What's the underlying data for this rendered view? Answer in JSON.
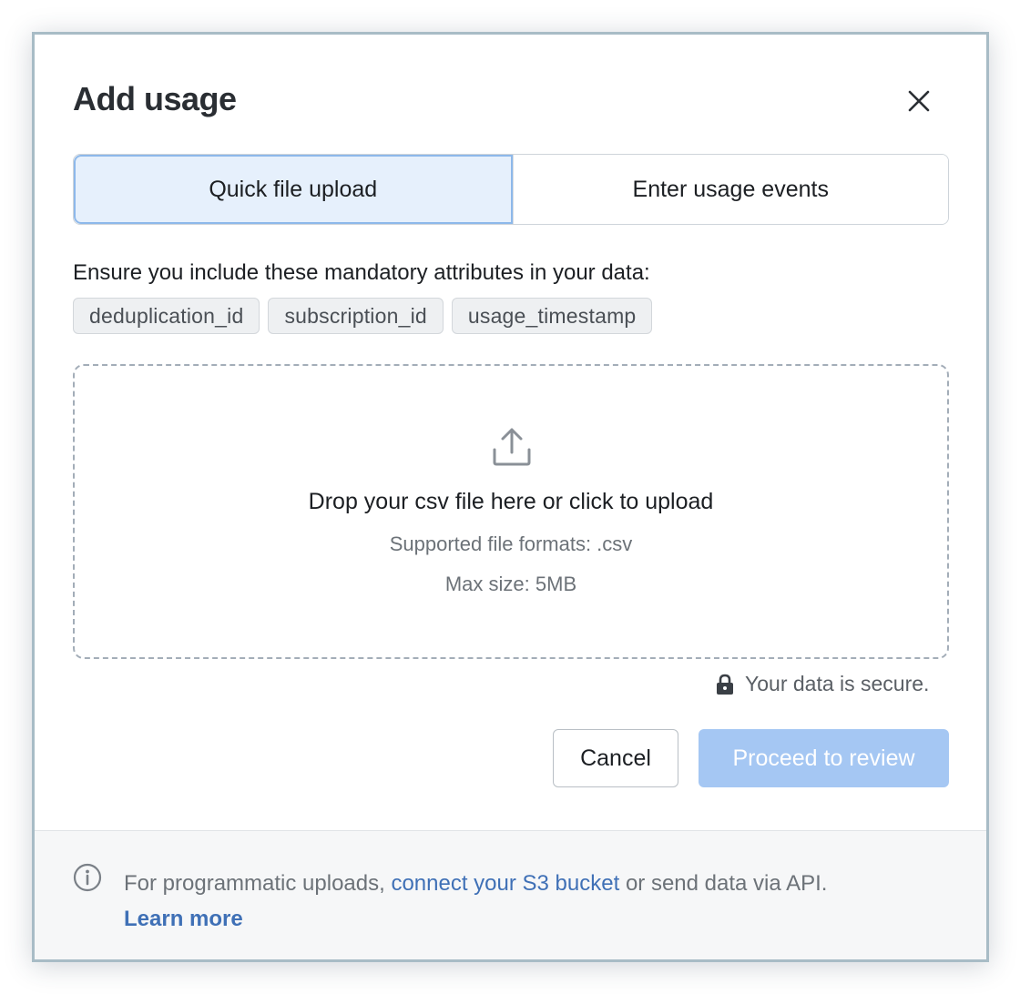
{
  "modal": {
    "title": "Add usage",
    "close_icon": "close-icon"
  },
  "tabs": [
    {
      "label": "Quick file upload",
      "active": true
    },
    {
      "label": "Enter usage events",
      "active": false
    }
  ],
  "attributes": {
    "intro": "Ensure you include these mandatory attributes in your data:",
    "chips": [
      "deduplication_id",
      "subscription_id",
      "usage_timestamp"
    ]
  },
  "dropzone": {
    "icon": "upload-icon",
    "main_text": "Drop your csv file here or click to upload",
    "formats_text": "Supported file formats: .csv",
    "max_size_text": "Max size: 5MB"
  },
  "security": {
    "icon": "lock-icon",
    "text": "Your data is secure."
  },
  "actions": {
    "cancel_label": "Cancel",
    "proceed_label": "Proceed to review",
    "proceed_disabled": true
  },
  "footer": {
    "icon": "info-icon",
    "text_before": "For programmatic uploads, ",
    "link_text": "connect your S3 bucket",
    "text_after": " or send data via API.",
    "learn_more": "Learn more"
  },
  "colors": {
    "accent": "#3f70b6",
    "active_tab_bg": "#e6f0fc",
    "active_tab_border": "#8db8ea",
    "disabled_primary": "#a5c7f3",
    "modal_border": "#a8bcc6"
  }
}
